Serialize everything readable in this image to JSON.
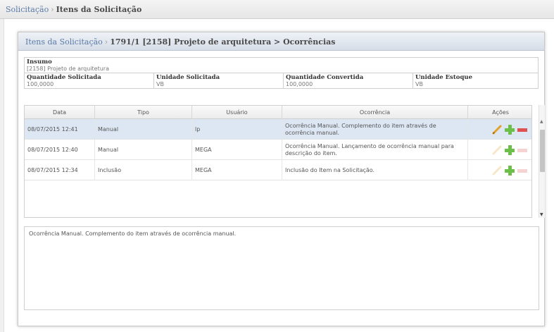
{
  "top_breadcrumb": {
    "parent": "Solicitação",
    "separator": "›",
    "current": "Itens da Solicitação"
  },
  "panel": {
    "title_parent": "Itens da Solicitação",
    "separator": "›",
    "title_current": "1791/1 [2158] Projeto de arquitetura > Ocorrências"
  },
  "info": {
    "insumo_label": "Insumo",
    "insumo_value": "[2158] Projeto de arquitetura",
    "fields": [
      {
        "label": "Quantidade Solicitada",
        "value": "100,0000"
      },
      {
        "label": "Unidade Solicitada",
        "value": "VB"
      },
      {
        "label": "Quantidade Convertida",
        "value": "100,0000"
      },
      {
        "label": "Unidade Estoque",
        "value": "VB"
      }
    ]
  },
  "grid": {
    "columns": [
      "Data",
      "Tipo",
      "Usuário",
      "Ocorrência",
      "Ações"
    ],
    "rows": [
      {
        "data": "08/07/2015 12:41",
        "tipo": "Manual",
        "usuario": "lp",
        "ocorrencia": "Ocorrência Manual. Complemento do item através de ocorrência manual.",
        "selected": true
      },
      {
        "data": "08/07/2015 12:40",
        "tipo": "Manual",
        "usuario": "MEGA",
        "ocorrencia": "Ocorrência Manual. Lançamento de ocorrência manual para descrição do item.",
        "selected": false
      },
      {
        "data": "08/07/2015 12:34",
        "tipo": "Inclusão",
        "usuario": "MEGA",
        "ocorrencia": "Inclusão do Item na Solicitação.",
        "selected": false
      }
    ]
  },
  "detail_text": "Ocorrência Manual. Complemento do item através de ocorrência manual.",
  "colors": {
    "edit_icon": "#e3a127",
    "add_icon": "#6cc04a",
    "remove_icon": "#e05050",
    "selected_row": "#dde7f3"
  },
  "icons": [
    "pencil-icon",
    "plus-icon",
    "minus-icon"
  ]
}
